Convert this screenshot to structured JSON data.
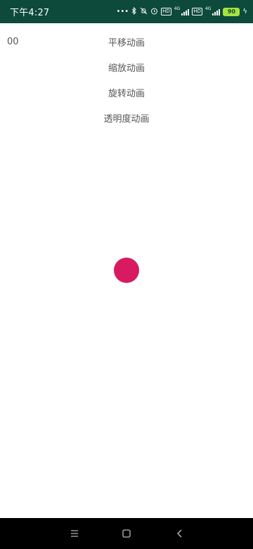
{
  "status_bar": {
    "time": "下午4:27",
    "dots": "•••",
    "hd_label": "HD",
    "net_label_1": "4G",
    "net_label_2": "4G",
    "battery_level": "90",
    "bolt": "ϟ"
  },
  "counter": "00",
  "buttons": [
    {
      "label": "平移动画"
    },
    {
      "label": "缩放动画"
    },
    {
      "label": "旋转动画"
    },
    {
      "label": "透明度动画"
    }
  ],
  "colors": {
    "status_bar_bg": "#0d4a3b",
    "ball": "#d81b60",
    "battery": "#a6e33d",
    "nav_bar_bg": "#000000"
  },
  "icons": {
    "bluetooth": "bluetooth-icon",
    "mute": "mute-bell-icon",
    "alarm": "alarm-icon",
    "menu": "menu-icon",
    "home": "home-square-icon",
    "back": "back-chevron-icon"
  }
}
